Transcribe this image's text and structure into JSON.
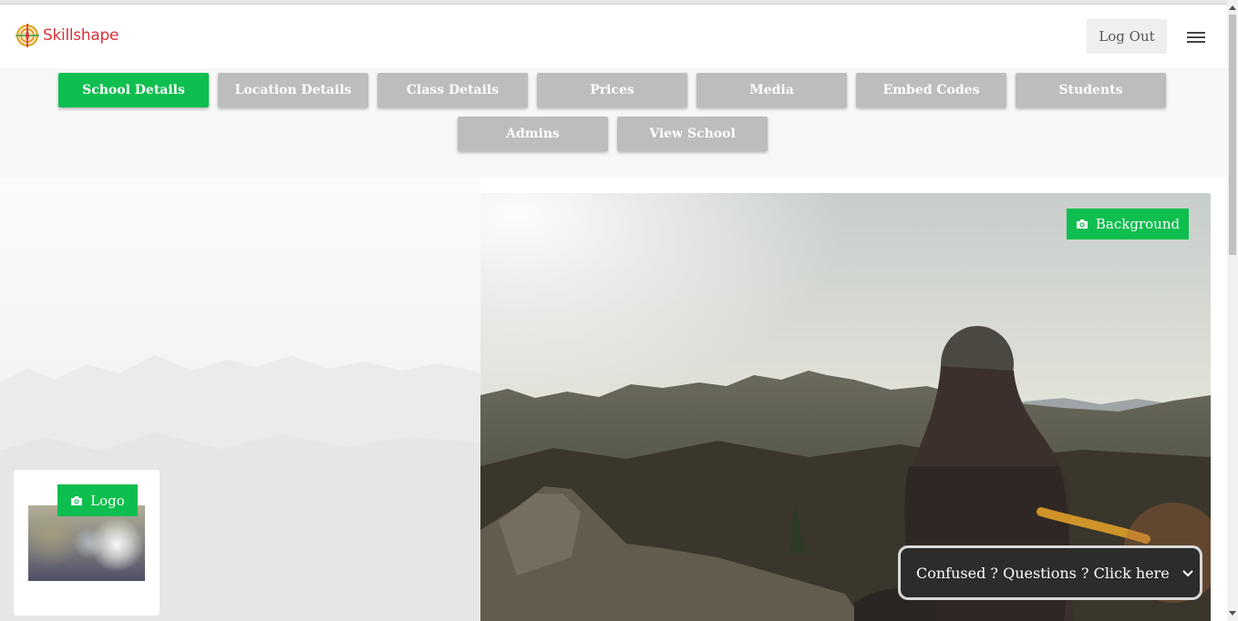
{
  "brand": {
    "name": "Skillshape",
    "icon": "compass-logo-icon"
  },
  "header": {
    "logout_label": "Log Out",
    "menu_icon": "hamburger-menu-icon"
  },
  "tabs": [
    {
      "label": "School Details",
      "active": true
    },
    {
      "label": "Location Details",
      "active": false
    },
    {
      "label": "Class Details",
      "active": false
    },
    {
      "label": "Prices",
      "active": false
    },
    {
      "label": "Media",
      "active": false
    },
    {
      "label": "Embed Codes",
      "active": false
    },
    {
      "label": "Students",
      "active": false
    },
    {
      "label": "Admins",
      "active": false
    },
    {
      "label": "View School",
      "active": false
    }
  ],
  "media": {
    "background_button_label": "Background",
    "logo_button_label": "Logo",
    "camera_icon": "camera-icon"
  },
  "help": {
    "label": "Confused ? Questions ? Click here",
    "icon": "chevron-down-icon"
  },
  "colors": {
    "accent": "#0ebe4e",
    "tab_inactive": "#bdbdbd",
    "brand": "#d6323a",
    "help_bg": "#2c2c2c"
  }
}
